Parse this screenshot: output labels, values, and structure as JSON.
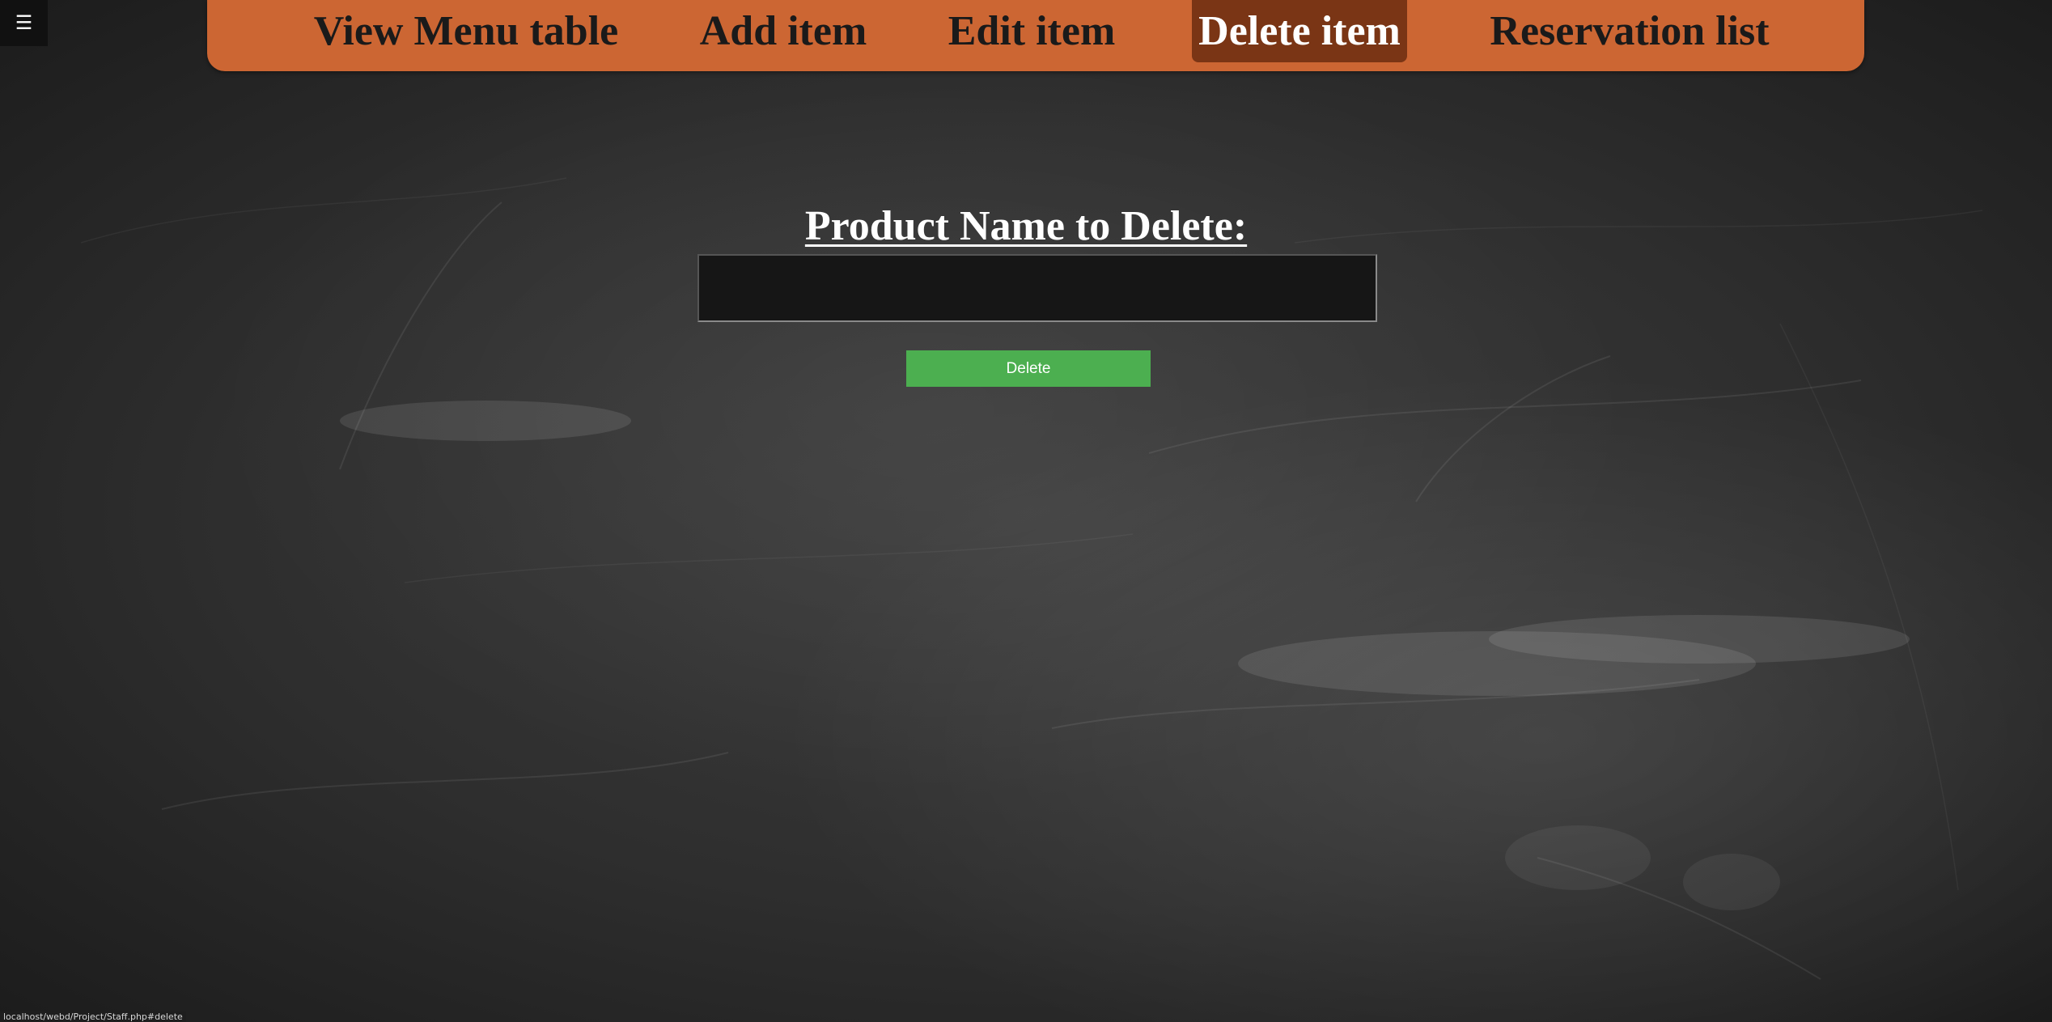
{
  "menu_toggle": {
    "icon": "hamburger-icon",
    "glyph": "☰"
  },
  "navbar": {
    "background_color": "#cc6633",
    "active_color": "#7a3515",
    "items": [
      {
        "label": "View Menu table"
      },
      {
        "label": "Add item"
      },
      {
        "label": "Edit item"
      },
      {
        "label": "Delete item",
        "active": true
      },
      {
        "label": "Reservation list"
      }
    ]
  },
  "form": {
    "title": "Product Name to Delete:",
    "input_value": "",
    "submit_label": "Delete",
    "submit_color": "#4caf50"
  },
  "status_bar": {
    "url": "localhost/webd/Project/Staff.php#delete"
  }
}
